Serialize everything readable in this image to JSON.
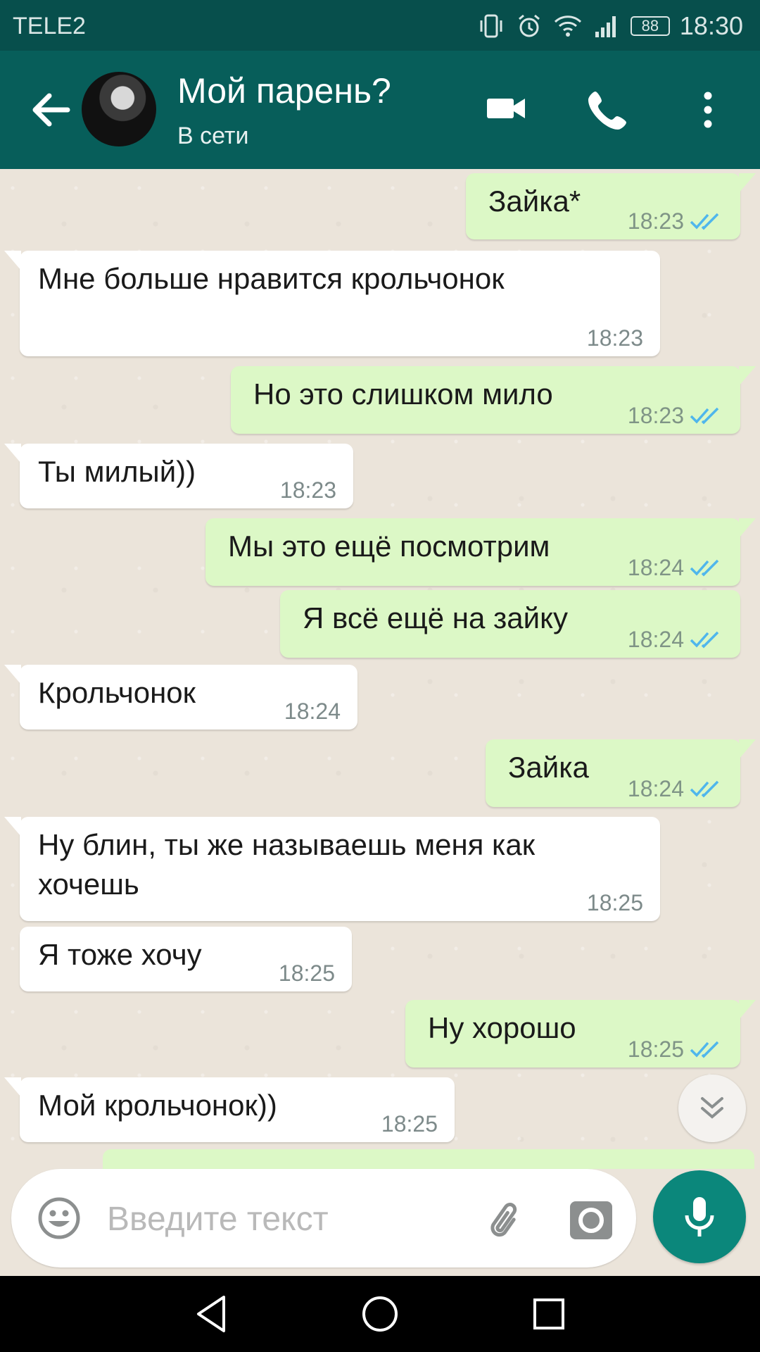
{
  "status_bar": {
    "carrier": "TELE2",
    "battery": "88",
    "time": "18:30"
  },
  "header": {
    "contact_name": "Мой парень?",
    "contact_status": "В сети"
  },
  "messages": [
    {
      "dir": "out",
      "text": "Зайка*",
      "time": "18:23",
      "status": "read"
    },
    {
      "dir": "in",
      "text": "Мне больше нравится крольчонок",
      "time": "18:23"
    },
    {
      "dir": "out",
      "text": "Но это слишком мило",
      "time": "18:23",
      "status": "read"
    },
    {
      "dir": "in",
      "text": "Ты милый))",
      "time": "18:23"
    },
    {
      "dir": "out",
      "text": "Мы это ещё посмотрим",
      "time": "18:24",
      "status": "read"
    },
    {
      "dir": "out",
      "text": "Я всё ещё на зайку",
      "time": "18:24",
      "status": "read"
    },
    {
      "dir": "in",
      "text": "Крольчонок",
      "time": "18:24"
    },
    {
      "dir": "out",
      "text": "Зайка",
      "time": "18:24",
      "status": "read"
    },
    {
      "dir": "in",
      "text": "Ну блин, ты же называешь меня как хочешь",
      "time": "18:25"
    },
    {
      "dir": "in",
      "text": "Я тоже хочу",
      "time": "18:25"
    },
    {
      "dir": "out",
      "text": "Ну хорошо",
      "time": "18:25",
      "status": "read"
    },
    {
      "dir": "in",
      "text": "Мой крольчонок))",
      "time": "18:25"
    }
  ],
  "composer": {
    "placeholder": "Введите текст"
  },
  "icons": {
    "back": "arrow-left-icon",
    "video": "video-camera-icon",
    "call": "phone-icon",
    "menu": "more-vert-icon",
    "emoji": "emoji-icon",
    "attach": "paperclip-icon",
    "camera": "camera-icon",
    "mic": "microphone-icon",
    "scroll": "double-chevron-down-icon",
    "read": "double-check-icon"
  },
  "colors": {
    "header": "#075e5a",
    "status_bar": "#074f4c",
    "outgoing": "#dcf8c6",
    "incoming": "#ffffff",
    "accent": "#0b877b",
    "read_ticks": "#4fb6ec"
  }
}
